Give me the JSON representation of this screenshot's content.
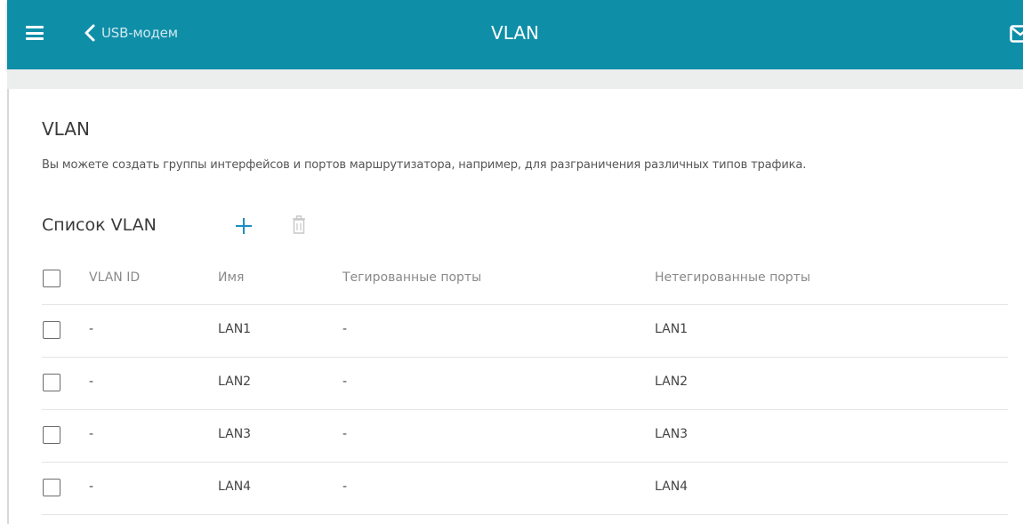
{
  "header": {
    "back_label": "USB-модем",
    "title": "VLAN",
    "menu_icon": "hamburger-icon",
    "back_icon": "chevron-left-icon",
    "mail_icon": "mail-icon",
    "bar_color": "#0f8ea8"
  },
  "section": {
    "title": "VLAN",
    "description": "Вы можете создать группы интерфейсов и портов маршрутизатора, например, для разграничения различных типов трафика."
  },
  "vlan_list": {
    "title": "Список VLAN",
    "add_icon": "plus-icon",
    "delete_icon": "trash-icon",
    "accent_color": "#1a8fc0",
    "columns": [
      "VLAN ID",
      "Имя",
      "Тегированные порты",
      "Нетегированные порты"
    ],
    "rows": [
      {
        "vlan_id": "-",
        "name": "LAN1",
        "tagged": "-",
        "untagged": "LAN1"
      },
      {
        "vlan_id": "-",
        "name": "LAN2",
        "tagged": "-",
        "untagged": "LAN2"
      },
      {
        "vlan_id": "-",
        "name": "LAN3",
        "tagged": "-",
        "untagged": "LAN3"
      },
      {
        "vlan_id": "-",
        "name": "LAN4",
        "tagged": "-",
        "untagged": "LAN4"
      }
    ]
  }
}
